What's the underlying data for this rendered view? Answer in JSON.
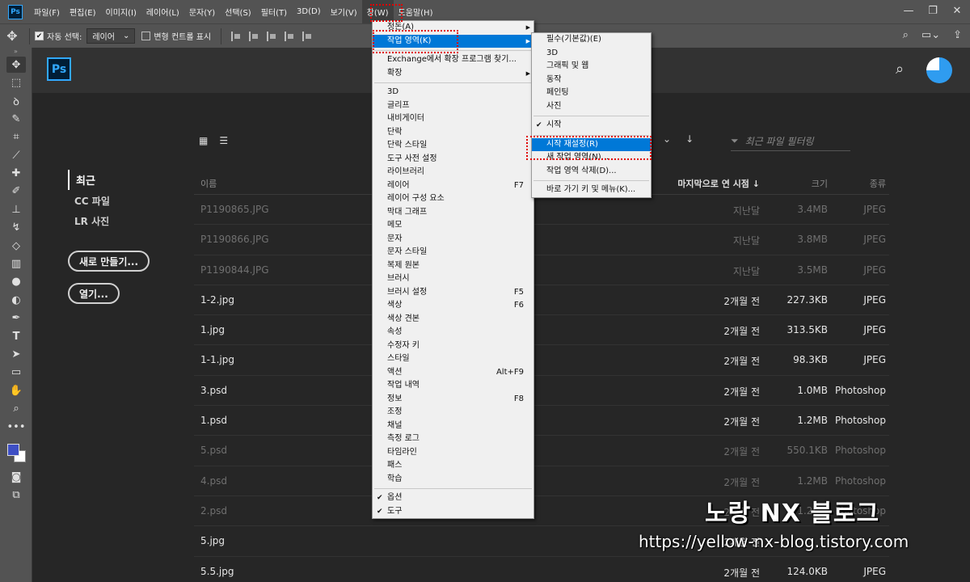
{
  "app": {
    "badge": "Ps"
  },
  "menubar": {
    "items": [
      "파일(F)",
      "편집(E)",
      "이미지(I)",
      "레이어(L)",
      "문자(Y)",
      "선택(S)",
      "필터(T)",
      "3D(D)",
      "보기(V)",
      "창(W)",
      "도움말(H)"
    ],
    "active_index": 9
  },
  "window_controls": {
    "minimize": "—",
    "restore": "❐",
    "close": "✕"
  },
  "options_bar": {
    "auto_select_label": "자동 선택:",
    "auto_select_value": "레이어",
    "transform_controls_label": "변형 컨트롤 표시"
  },
  "home": {
    "logo": "Ps",
    "nav": [
      "최근",
      "CC 파일",
      "LR 사진"
    ],
    "create_new": "새로 만들기...",
    "open": "열기...",
    "filter_placeholder": "최근 파일 필터링",
    "columns": {
      "name": "이름",
      "last_opened": "마지막으로 연 시점",
      "size": "크기",
      "type": "종류"
    },
    "files": [
      {
        "name": "P1190865.JPG",
        "date": "지난달",
        "size": "3.4MB",
        "type": "JPEG",
        "dim": true
      },
      {
        "name": "P1190866.JPG",
        "date": "지난달",
        "size": "3.8MB",
        "type": "JPEG",
        "dim": true
      },
      {
        "name": "P1190844.JPG",
        "date": "지난달",
        "size": "3.5MB",
        "type": "JPEG",
        "dim": true
      },
      {
        "name": "1-2.jpg",
        "date": "2개월 전",
        "size": "227.3KB",
        "type": "JPEG",
        "dim": false
      },
      {
        "name": "1.jpg",
        "date": "2개월 전",
        "size": "313.5KB",
        "type": "JPEG",
        "dim": false
      },
      {
        "name": "1-1.jpg",
        "date": "2개월 전",
        "size": "98.3KB",
        "type": "JPEG",
        "dim": false
      },
      {
        "name": "3.psd",
        "date": "2개월 전",
        "size": "1.0MB",
        "type": "Photoshop",
        "dim": false
      },
      {
        "name": "1.psd",
        "date": "2개월 전",
        "size": "1.2MB",
        "type": "Photoshop",
        "dim": false
      },
      {
        "name": "5.psd",
        "date": "2개월 전",
        "size": "550.1KB",
        "type": "Photoshop",
        "dim": true
      },
      {
        "name": "4.psd",
        "date": "2개월 전",
        "size": "1.2MB",
        "type": "Photoshop",
        "dim": true
      },
      {
        "name": "2.psd",
        "date": "2개월 전",
        "size": "1.2MB",
        "type": "Photoshop",
        "dim": true
      },
      {
        "name": "5.jpg",
        "date": "2개월 전",
        "size": "",
        "type": "",
        "dim": false
      },
      {
        "name": "5.5.jpg",
        "date": "2개월 전",
        "size": "124.0KB",
        "type": "JPEG",
        "dim": false
      }
    ]
  },
  "window_menu": {
    "items": [
      {
        "label": "정돈(A)",
        "submenu": true
      },
      {
        "label": "작업 영역(K)",
        "submenu": true,
        "highlighted": true
      },
      {
        "sep": true
      },
      {
        "label": "Exchange에서 확장 프로그램 찾기..."
      },
      {
        "label": "확장",
        "submenu": true
      },
      {
        "sep": true
      },
      {
        "label": "3D"
      },
      {
        "label": "글리프"
      },
      {
        "label": "내비게이터"
      },
      {
        "label": "단락"
      },
      {
        "label": "단락 스타일"
      },
      {
        "label": "도구 사전 설정"
      },
      {
        "label": "라이브러리"
      },
      {
        "label": "레이어",
        "shortcut": "F7"
      },
      {
        "label": "레이어 구성 요소"
      },
      {
        "label": "막대 그래프"
      },
      {
        "label": "메모"
      },
      {
        "label": "문자"
      },
      {
        "label": "문자 스타일"
      },
      {
        "label": "복제 원본"
      },
      {
        "label": "브러시"
      },
      {
        "label": "브러시 설정",
        "shortcut": "F5"
      },
      {
        "label": "색상",
        "shortcut": "F6"
      },
      {
        "label": "색상 견본"
      },
      {
        "label": "속성"
      },
      {
        "label": "수정자 키"
      },
      {
        "label": "스타일"
      },
      {
        "label": "액션",
        "shortcut": "Alt+F9"
      },
      {
        "label": "작업 내역"
      },
      {
        "label": "정보",
        "shortcut": "F8"
      },
      {
        "label": "조정"
      },
      {
        "label": "채널"
      },
      {
        "label": "측정 로그"
      },
      {
        "label": "타임라인"
      },
      {
        "label": "패스"
      },
      {
        "label": "학습"
      },
      {
        "sep": true
      },
      {
        "label": "옵션",
        "checked": true
      },
      {
        "label": "도구",
        "checked": true
      }
    ]
  },
  "workspace_menu": {
    "items": [
      {
        "label": "필수(기본값)(E)"
      },
      {
        "label": "3D"
      },
      {
        "label": "그래픽 및 웹"
      },
      {
        "label": "동작"
      },
      {
        "label": "페인팅"
      },
      {
        "label": "사진"
      },
      {
        "sep": true
      },
      {
        "label": "시작",
        "checked": true
      },
      {
        "sep": true
      },
      {
        "label": "시작 재설정(R)",
        "highlighted": true
      },
      {
        "label": "새 작업 영역(N)..."
      },
      {
        "label": "작업 영역 삭제(D)..."
      },
      {
        "sep": true
      },
      {
        "label": "바로 가기 키 및 메뉴(K)..."
      }
    ]
  },
  "watermark": {
    "title": "노랑 NX 블로그",
    "url": "https://yellow-nx-blog.tistory.com"
  },
  "colors": {
    "accent": "#0078d7",
    "highlight_box": "#e00000",
    "foreground": "#3e4fc4",
    "background": "#ffffff"
  }
}
